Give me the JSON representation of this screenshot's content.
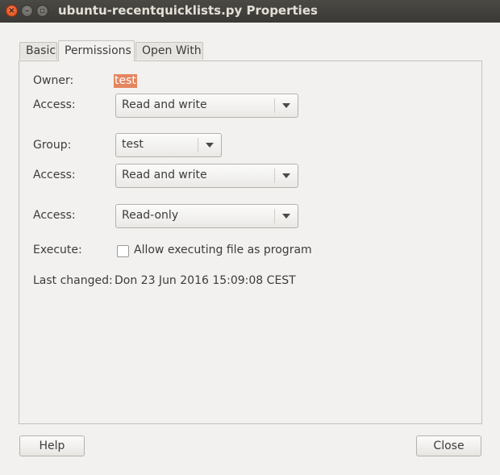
{
  "window": {
    "title": "ubuntu-recentquicklists.py Properties",
    "controls": {
      "close": "×",
      "minimize": "–",
      "maximize": "▫"
    }
  },
  "tabs": [
    {
      "label": "Basic",
      "active": false
    },
    {
      "label": "Permissions",
      "active": true
    },
    {
      "label": "Open With",
      "active": false
    }
  ],
  "permissions": {
    "owner_label": "Owner:",
    "owner_value": "test",
    "owner_access_label": "Access:",
    "owner_access_value": "Read and write",
    "group_label": "Group:",
    "group_value": "test",
    "group_access_label": "Access:",
    "group_access_value": "Read and write",
    "others_access_label": "Access:",
    "others_access_value": "Read-only",
    "execute_label": "Execute:",
    "execute_checkbox_label": "Allow executing file as program",
    "execute_checked": false,
    "last_changed_label": "Last changed:",
    "last_changed_value": "Don 23 Jun 2016 15:09:08 CEST"
  },
  "buttons": {
    "help": "Help",
    "close": "Close"
  },
  "colors": {
    "titlebar": "#3c3b37",
    "selection": "#e5855f",
    "close_button": "#df4a16"
  }
}
